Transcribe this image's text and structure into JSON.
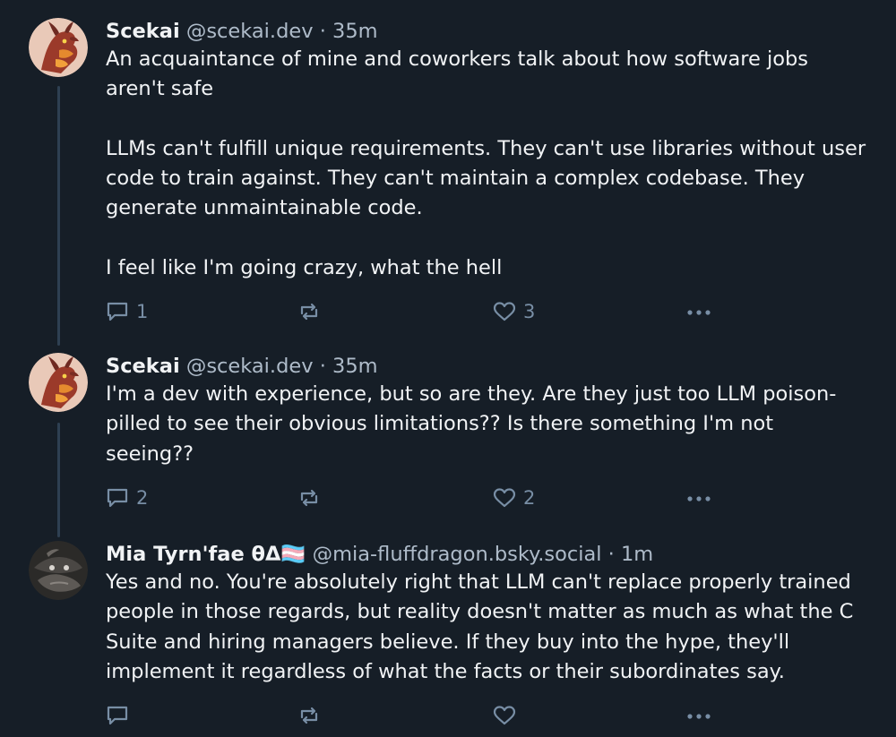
{
  "thread": {
    "posts": [
      {
        "author_name": "Scekai",
        "handle": "@scekai.dev",
        "separator": "·",
        "time": "35m",
        "paragraphs": [
          "An acquaintance of mine and coworkers talk about how software jobs aren't safe",
          "LLMs can't fulfill unique requirements. They can't use libraries without user code to train against. They can't maintain a complex codebase. They generate unmaintainable code.",
          "I feel like I'm going crazy, what the hell"
        ],
        "reply_count": "1",
        "repost_count": "",
        "like_count": "3",
        "avatar_icon": "dragon-avatar-red-orange"
      },
      {
        "author_name": "Scekai",
        "handle": "@scekai.dev",
        "separator": "·",
        "time": "35m",
        "paragraphs": [
          "I'm a dev with experience, but so are they. Are they just too LLM poison-pilled to see their obvious limitations?? Is there something I'm not seeing??"
        ],
        "reply_count": "2",
        "repost_count": "",
        "like_count": "2",
        "avatar_icon": "dragon-avatar-red-orange"
      },
      {
        "author_name": "Mia Tyrn'fae θΔ🏳️‍⚧️",
        "handle": "@mia-fluffdragon.bsky.social",
        "separator": "·",
        "time": "1m",
        "paragraphs": [
          "Yes and no. You're absolutely right that LLM can't replace properly trained people in those regards, but reality doesn't matter as much as what the C Suite and hiring managers believe. If they buy into the hype, they'll implement it regardless of what the facts or their subordinates say."
        ],
        "reply_count": "",
        "repost_count": "",
        "like_count": "",
        "avatar_icon": "dark-dragon-avatar"
      }
    ]
  },
  "icons": {
    "reply": "reply-bubble-icon",
    "repost": "repost-icon",
    "like": "heart-icon",
    "more": "more-dots-icon"
  },
  "colors": {
    "background": "#161e27",
    "text": "#f1f3f5",
    "muted": "#aebbc9",
    "icon": "#788ea5",
    "thread_line": "#2e4052"
  }
}
